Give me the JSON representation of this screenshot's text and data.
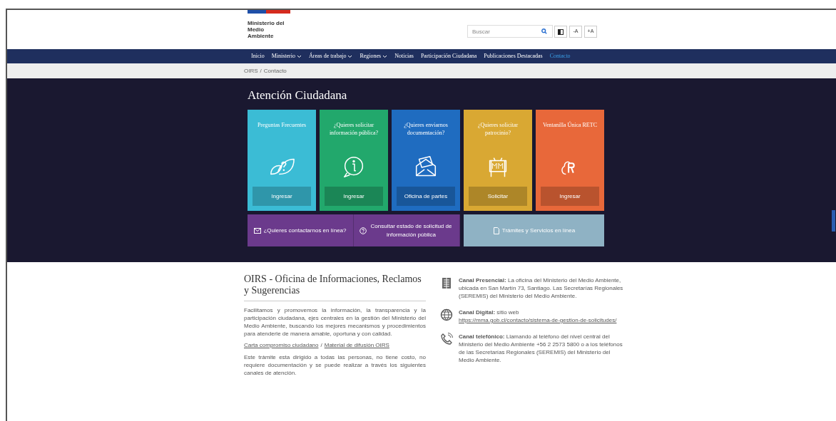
{
  "header": {
    "logo_lines": [
      "Ministerio del",
      "Medio",
      "Ambiente"
    ],
    "search": {
      "placeholder": "Buscar"
    },
    "tools": [
      {
        "kind": "contrast"
      },
      {
        "kind": "text",
        "label": "-A"
      },
      {
        "kind": "text",
        "label": "+A"
      }
    ]
  },
  "nav": [
    {
      "label": "Inicio",
      "dropdown": false,
      "selected": false
    },
    {
      "label": "Ministerio",
      "dropdown": true,
      "selected": false
    },
    {
      "label": "Áreas de trabajo",
      "dropdown": true,
      "selected": false
    },
    {
      "label": "Regiones",
      "dropdown": true,
      "selected": false
    },
    {
      "label": "Noticias",
      "dropdown": false,
      "selected": false
    },
    {
      "label": "Participación Ciudadana",
      "dropdown": false,
      "selected": false
    },
    {
      "label": "Publicaciones Destacadas",
      "dropdown": false,
      "selected": false
    },
    {
      "label": "Contacto",
      "dropdown": false,
      "selected": true
    }
  ],
  "breadcrumb": {
    "items": [
      "OIRS",
      "Contacto"
    ],
    "separator": "/"
  },
  "hero": {
    "title": "Atención Ciudadana",
    "cards": [
      {
        "title": "Preguntas Frecuentes",
        "button": "Ingresar",
        "color": "#3bbcd5"
      },
      {
        "title": "¿Quieres solicitar información pública?",
        "button": "Ingresar",
        "color": "#22a86c"
      },
      {
        "title": "¿Quieres enviarnos documentación?",
        "button": "Oficina de partes",
        "color": "#1f6cc0"
      },
      {
        "title": "¿Quieres solicitar patrocinio?",
        "button": "Solicitar",
        "color": "#d9a833"
      },
      {
        "title": "Ventanilla Única RETC",
        "button": "Ingresar",
        "color": "#e8683a"
      }
    ],
    "links": [
      {
        "label": "¿Quieres contactarnos en línea?",
        "color": "#6b3a8c"
      },
      {
        "label": "Consultar estado de solicitud de información pública",
        "color": "#6b3a8c"
      },
      {
        "label": "Trámites y Servicios en línea",
        "color": "#8fb2c4"
      }
    ]
  },
  "oirs": {
    "title": "OIRS - Oficina de Informaciones, Reclamos y Sugerencias",
    "intro": "Facilitamos y promovemos la información, la transparencia y la participación ciudadana, ejes centrales en la gestión del Ministerio del Medio Ambiente, buscando los mejores mecanismos y procedimientos para atenderle de manera amable, oportuna y con calidad.",
    "links": [
      "Carta compromiso ciudadano",
      "Material de difusión OIRS"
    ],
    "separator": "/",
    "note": "Este trámite esta dirigido a todas las personas, no tiene costo, no requiere documentación y se puede realizar a través los siguientes canales de atención."
  },
  "channels": [
    {
      "text": "**Canal Presencial:** La oficina del Ministerio del Medio Ambiente, ubicada en San Martín 73, Santiago. Las Secretarías Regionales (SEREMIS) del Ministerio del Medio Ambiente."
    },
    {
      "text": "**Canal Digital:** sitio web",
      "link": "https://mma.gob.cl/contacto/sistema-de-gestion-de-solicitudes/"
    },
    {
      "text": "**Canal telefónico:** Llamando al teléfono del nivel central del Ministerio del Medio Ambiente +56 2 2573 5800 o a los teléfonos de las Secretarías Regionales (SEREMIS) del Ministerio del Medio Ambiente."
    }
  ]
}
